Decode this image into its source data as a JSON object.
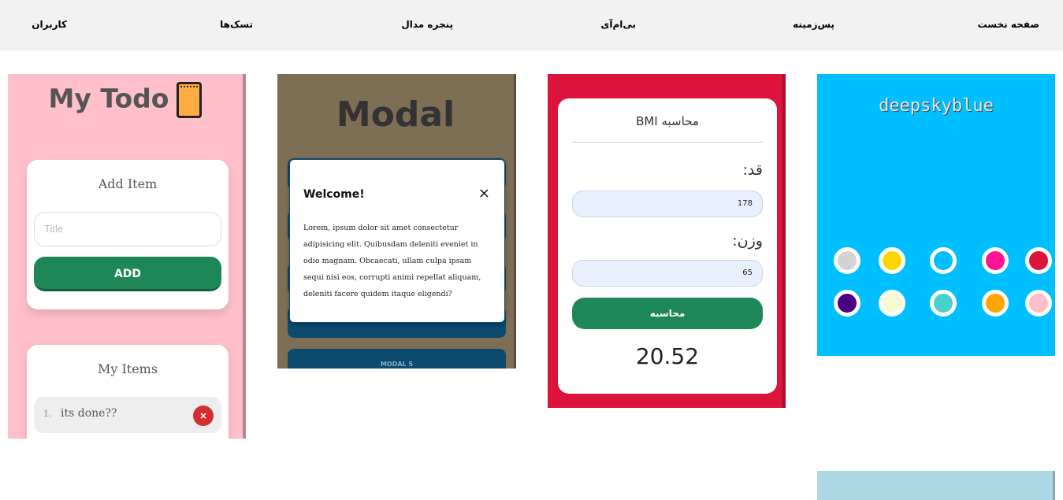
{
  "nav": {
    "items": [
      "صفحه نخست",
      "پس‌زمینه",
      "بی‌ام‌آی",
      "پنجره مدال",
      "تسک‌ها",
      "کاربران"
    ]
  },
  "todo": {
    "title": "My Todo",
    "add_heading": "Add Item",
    "input_placeholder": "Title",
    "add_button": "ADD",
    "items_heading": "My Items",
    "items": [
      {
        "num": "1.",
        "text": "its done??",
        "delete": "×"
      }
    ],
    "bg_color": "#ffc0cb"
  },
  "modal": {
    "title": "Modal",
    "header": "Welcome!",
    "close": "×",
    "body": "Lorem, ipsum dolor sit amet consectetur adipisicing elit. Quibusdam deleniti eveniet in odio magnam. Obcaecati, ullam culpa ipsam sequi nisi eos, corrupti animi repellat aliquam, deleniti facere quidem itaque eligendi?",
    "bottom_button": "MODAL 5"
  },
  "bmi": {
    "title": "محاسبه BMI",
    "height_label": "قد:",
    "height_value": "178",
    "weight_label": "وزن:",
    "weight_value": "65",
    "calc_button": "محاسبه",
    "result": "20.52",
    "bg_color": "#dc143c"
  },
  "colors": {
    "title": "deepskyblue",
    "bg_color": "#00bfff",
    "swatches": [
      "crimson",
      "deeppink",
      "deepskyblue",
      "gold",
      "lightgray",
      "pink",
      "orange",
      "mediumturquoise",
      "lightgoldenrodyellow",
      "indigo"
    ]
  }
}
